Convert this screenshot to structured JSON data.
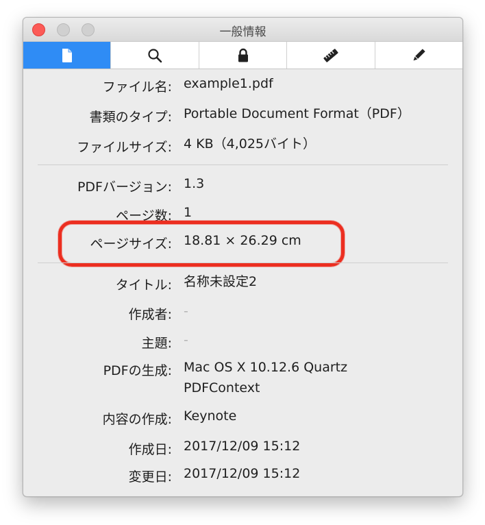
{
  "window": {
    "title": "一般情報"
  },
  "tabs": [
    {
      "icon": "document-icon",
      "active": true
    },
    {
      "icon": "search-icon",
      "active": false
    },
    {
      "icon": "lock-icon",
      "active": false
    },
    {
      "icon": "ruler-icon",
      "active": false
    },
    {
      "icon": "pencil-icon",
      "active": false
    }
  ],
  "info": {
    "file_name": {
      "label": "ファイル名:",
      "value": "example1.pdf"
    },
    "doc_type": {
      "label": "書類のタイプ:",
      "value": "Portable Document Format（PDF）"
    },
    "file_size": {
      "label": "ファイルサイズ:",
      "value": "4 KB（4,025バイト）"
    },
    "pdf_version": {
      "label": "PDFバージョン:",
      "value": "1.3"
    },
    "page_count": {
      "label": "ページ数:",
      "value": "1"
    },
    "page_size": {
      "label": "ページサイズ:",
      "value": "18.81 × 26.29 cm"
    },
    "title": {
      "label": "タイトル:",
      "value": "名称未設定2"
    },
    "author": {
      "label": "作成者:",
      "value": "-"
    },
    "subject": {
      "label": "主題:",
      "value": "-"
    },
    "producer": {
      "label": "PDFの生成:",
      "value_line1": "Mac OS X 10.12.6 Quartz",
      "value_line2": "PDFContext"
    },
    "creator": {
      "label": "内容の作成:",
      "value": "Keynote"
    },
    "created": {
      "label": "作成日:",
      "value": "2017/12/09 15:12"
    },
    "modified": {
      "label": "変更日:",
      "value": "2017/12/09 15:12"
    }
  },
  "colors": {
    "accent": "#2f8cf5",
    "highlight": "#ec2e20",
    "close_button": "#fc5b57"
  }
}
